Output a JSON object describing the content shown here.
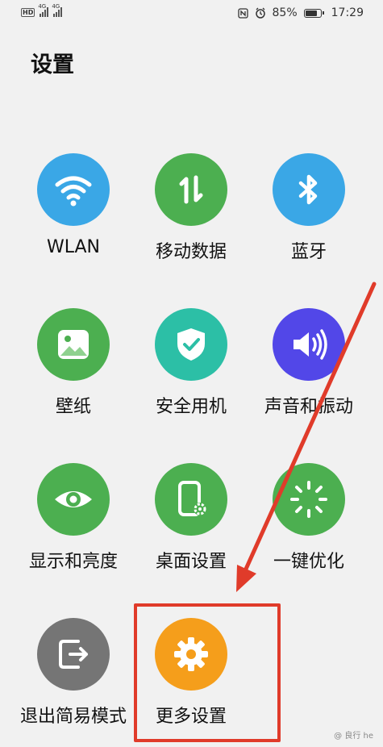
{
  "status_bar": {
    "hd": "HD",
    "sim1_label": "4G",
    "sim2_label": "4G",
    "battery": "85%",
    "battery_level": 0.85,
    "time": "17:29",
    "icons": [
      "nfc-icon",
      "alarm-icon",
      "battery-icon"
    ]
  },
  "page": {
    "title": "设置"
  },
  "tiles": [
    {
      "label": "WLAN",
      "icon": "wifi-icon",
      "color": "#3aa7e6"
    },
    {
      "label": "移动数据",
      "icon": "mobile-data-icon",
      "color": "#4caf50"
    },
    {
      "label": "蓝牙",
      "icon": "bluetooth-icon",
      "color": "#3aa7e6"
    },
    {
      "label": "壁纸",
      "icon": "wallpaper-icon",
      "color": "#4caf50"
    },
    {
      "label": "安全用机",
      "icon": "shield-icon",
      "color": "#2cbfa6"
    },
    {
      "label": "声音和振动",
      "icon": "speaker-icon",
      "color": "#5247e8"
    },
    {
      "label": "显示和亮度",
      "icon": "eye-icon",
      "color": "#4caf50"
    },
    {
      "label": "桌面设置",
      "icon": "phone-settings-icon",
      "color": "#4caf50"
    },
    {
      "label": "一键优化",
      "icon": "optimize-icon",
      "color": "#4caf50"
    },
    {
      "label": "退出简易模式",
      "icon": "exit-icon",
      "color": "#757575"
    },
    {
      "label": "更多设置",
      "icon": "gear-icon",
      "color": "#f59e1b"
    }
  ],
  "annotation": {
    "color": "#e03b2a"
  },
  "watermark": "@ 良行 he"
}
